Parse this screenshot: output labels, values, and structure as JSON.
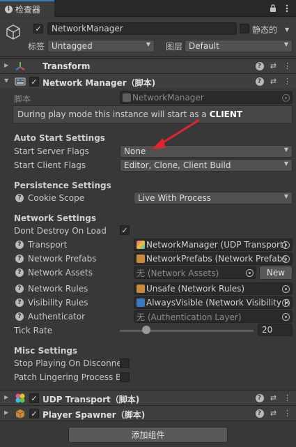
{
  "tab": {
    "title": "检查器",
    "lock_icon": "lock-icon",
    "menu_icon": "kebab-menu-icon"
  },
  "gameobject": {
    "name": "NetworkManager",
    "static_label": "静态的",
    "tag_label": "标签",
    "tag_value": "Untagged",
    "layer_label": "图层",
    "layer_value": "Default"
  },
  "components": {
    "transform": {
      "title": "Transform"
    },
    "network_manager": {
      "title": "Network Manager（脚本)"
    },
    "udp": {
      "title": "UDP Transport（脚本)"
    },
    "spawner": {
      "title": "Player Spawner（脚本)"
    }
  },
  "nm": {
    "script_label": "脚本",
    "script_value": "NetworkManager",
    "info_text": "During play mode this instance will start as a",
    "info_mode": "CLIENT",
    "auto_start": {
      "heading": "Auto Start Settings",
      "server_label": "Start Server Flags",
      "server_value": "None",
      "client_label": "Start Client Flags",
      "client_value": "Editor, Clone, Client Build"
    },
    "persistence": {
      "heading": "Persistence Settings",
      "cookie_label": "Cookie Scope",
      "cookie_value": "Live With Process"
    },
    "network": {
      "heading": "Network Settings",
      "dont_destroy_label": "Dont Destroy On Load",
      "transport_label": "Transport",
      "transport_value": "NetworkManager (UDP Transport)",
      "prefabs_label": "Network Prefabs",
      "prefabs_value": "NetworkPrefabs (Network Prefabs",
      "assets_label": "Network Assets",
      "assets_value": "无 (Network Assets)",
      "new_button": "New",
      "rules_label": "Network Rules",
      "rules_value": "Unsafe (Network Rules)",
      "visibility_label": "Visibility Rules",
      "visibility_value": "AlwaysVisible (Network Visibility R",
      "auth_label": "Authenticator",
      "auth_value": "无 (Authentication Layer)",
      "tickrate_label": "Tick Rate",
      "tickrate_value": "20",
      "tickrate_fraction": 0.2
    },
    "misc": {
      "heading": "Misc Settings",
      "stop_label": "Stop Playing On Disconnec",
      "patch_label": "Patch Lingering Process Bu"
    }
  },
  "add_component_button": "添加组件",
  "colors": {
    "accent": "#3a79bb",
    "annotation_arrow": "#e0262a"
  }
}
